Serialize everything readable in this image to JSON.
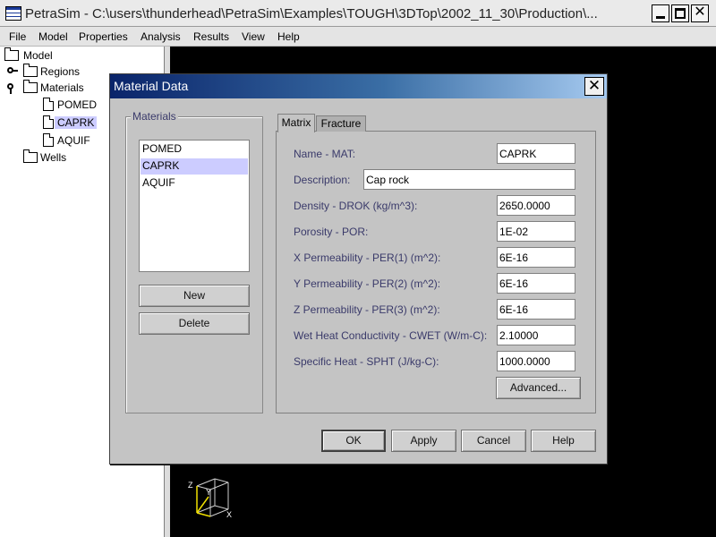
{
  "window": {
    "title": "PetraSim - C:\\users\\thunderhead\\PetraSim\\Examples\\TOUGH\\3DTop\\2002_11_30\\Production\\..."
  },
  "menu": [
    "File",
    "Model",
    "Properties",
    "Analysis",
    "Results",
    "View",
    "Help"
  ],
  "tree": {
    "root": "Model",
    "regions": "Regions",
    "materials": "Materials",
    "material_items": [
      "POMED",
      "CAPRK",
      "AQUIF"
    ],
    "wells": "Wells"
  },
  "axes": {
    "x": "X",
    "y": "Y",
    "z": "Z"
  },
  "dialog": {
    "title": "Material Data",
    "materials_group": "Materials",
    "materials_list": [
      "POMED",
      "CAPRK",
      "AQUIF"
    ],
    "new_label": "New",
    "delete_label": "Delete",
    "tabs": [
      "Matrix",
      "Fracture"
    ],
    "fields": [
      {
        "label": "Name - MAT:",
        "value": "CAPRK"
      },
      {
        "label": "Description:",
        "value": "Cap rock"
      },
      {
        "label": "Density - DROK (kg/m^3):",
        "value": "2650.0000"
      },
      {
        "label": "Porosity - POR:",
        "value": "1E-02"
      },
      {
        "label": "X Permeability - PER(1) (m^2):",
        "value": "6E-16"
      },
      {
        "label": "Y Permeability - PER(2) (m^2):",
        "value": "6E-16"
      },
      {
        "label": "Z Permeability - PER(3) (m^2):",
        "value": "6E-16"
      },
      {
        "label": "Wet Heat Conductivity - CWET (W/m-C):",
        "value": "2.10000"
      },
      {
        "label": "Specific Heat - SPHT (J/kg-C):",
        "value": "1000.0000"
      }
    ],
    "advanced_label": "Advanced...",
    "ok_label": "OK",
    "apply_label": "Apply",
    "cancel_label": "Cancel",
    "help_label": "Help"
  }
}
